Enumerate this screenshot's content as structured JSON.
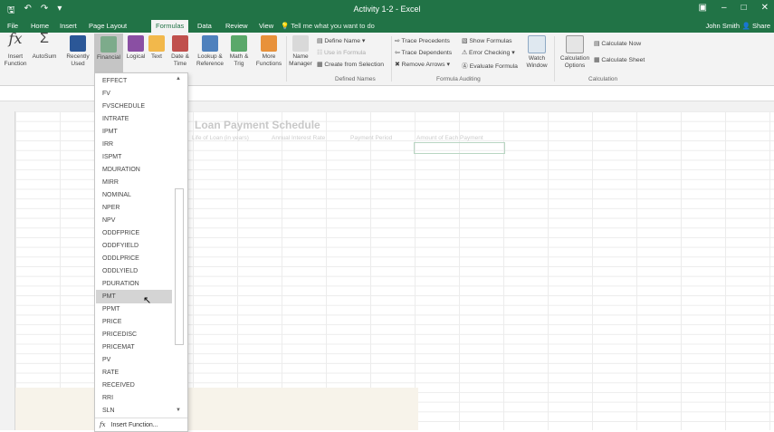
{
  "window": {
    "title": "Activity 1-2 - Excel",
    "user": "John Smith",
    "share": "Share"
  },
  "tabs": [
    "File",
    "Home",
    "Insert",
    "Page Layout",
    "Formulas",
    "Data",
    "Review",
    "View"
  ],
  "active_tab": "Formulas",
  "tell_me": "Tell me what you want to do",
  "ribbon": {
    "insert_function": "Insert Function",
    "autosum": "AutoSum",
    "recently_used": "Recently Used",
    "financial": "Financial",
    "logical": "Logical",
    "text": "Text",
    "date_time": "Date & Time",
    "lookup_reference": "Lookup & Reference",
    "math_trig": "Math & Trig",
    "more_functions": "More Functions",
    "name_manager": "Name Manager",
    "define_name": "Define Name",
    "use_in_formula": "Use in Formula",
    "create_from_selection": "Create from Selection",
    "defined_names_group": "Defined Names",
    "trace_precedents": "Trace Precedents",
    "trace_dependents": "Trace Dependents",
    "remove_arrows": "Remove Arrows",
    "show_formulas": "Show Formulas",
    "error_checking": "Error Checking",
    "evaluate_formula": "Evaluate Formula",
    "formula_auditing_group": "Formula Auditing",
    "watch_window": "Watch Window",
    "calculation_options": "Calculation Options",
    "calculate_now": "Calculate Now",
    "calculate_sheet": "Calculate Sheet",
    "calculation_group": "Calculation"
  },
  "sheet": {
    "title": "Loan Payment Schedule",
    "headers": [
      "Life of Loan (in years)",
      "Annual Interest Rate",
      "Payment Period",
      "Amount of Each Payment"
    ]
  },
  "dropdown": {
    "items": [
      "EFFECT",
      "FV",
      "FVSCHEDULE",
      "INTRATE",
      "IPMT",
      "IRR",
      "ISPMT",
      "MDURATION",
      "MIRR",
      "NOMINAL",
      "NPER",
      "NPV",
      "ODDFPRICE",
      "ODDFYIELD",
      "ODDLPRICE",
      "ODDLYIELD",
      "PDURATION",
      "PMT",
      "PPMT",
      "PRICE",
      "PRICEDISC",
      "PRICEMAT",
      "PV",
      "RATE",
      "RECEIVED",
      "RRI",
      "SLN"
    ],
    "highlighted": "PMT",
    "insert_function": "Insert Function..."
  }
}
